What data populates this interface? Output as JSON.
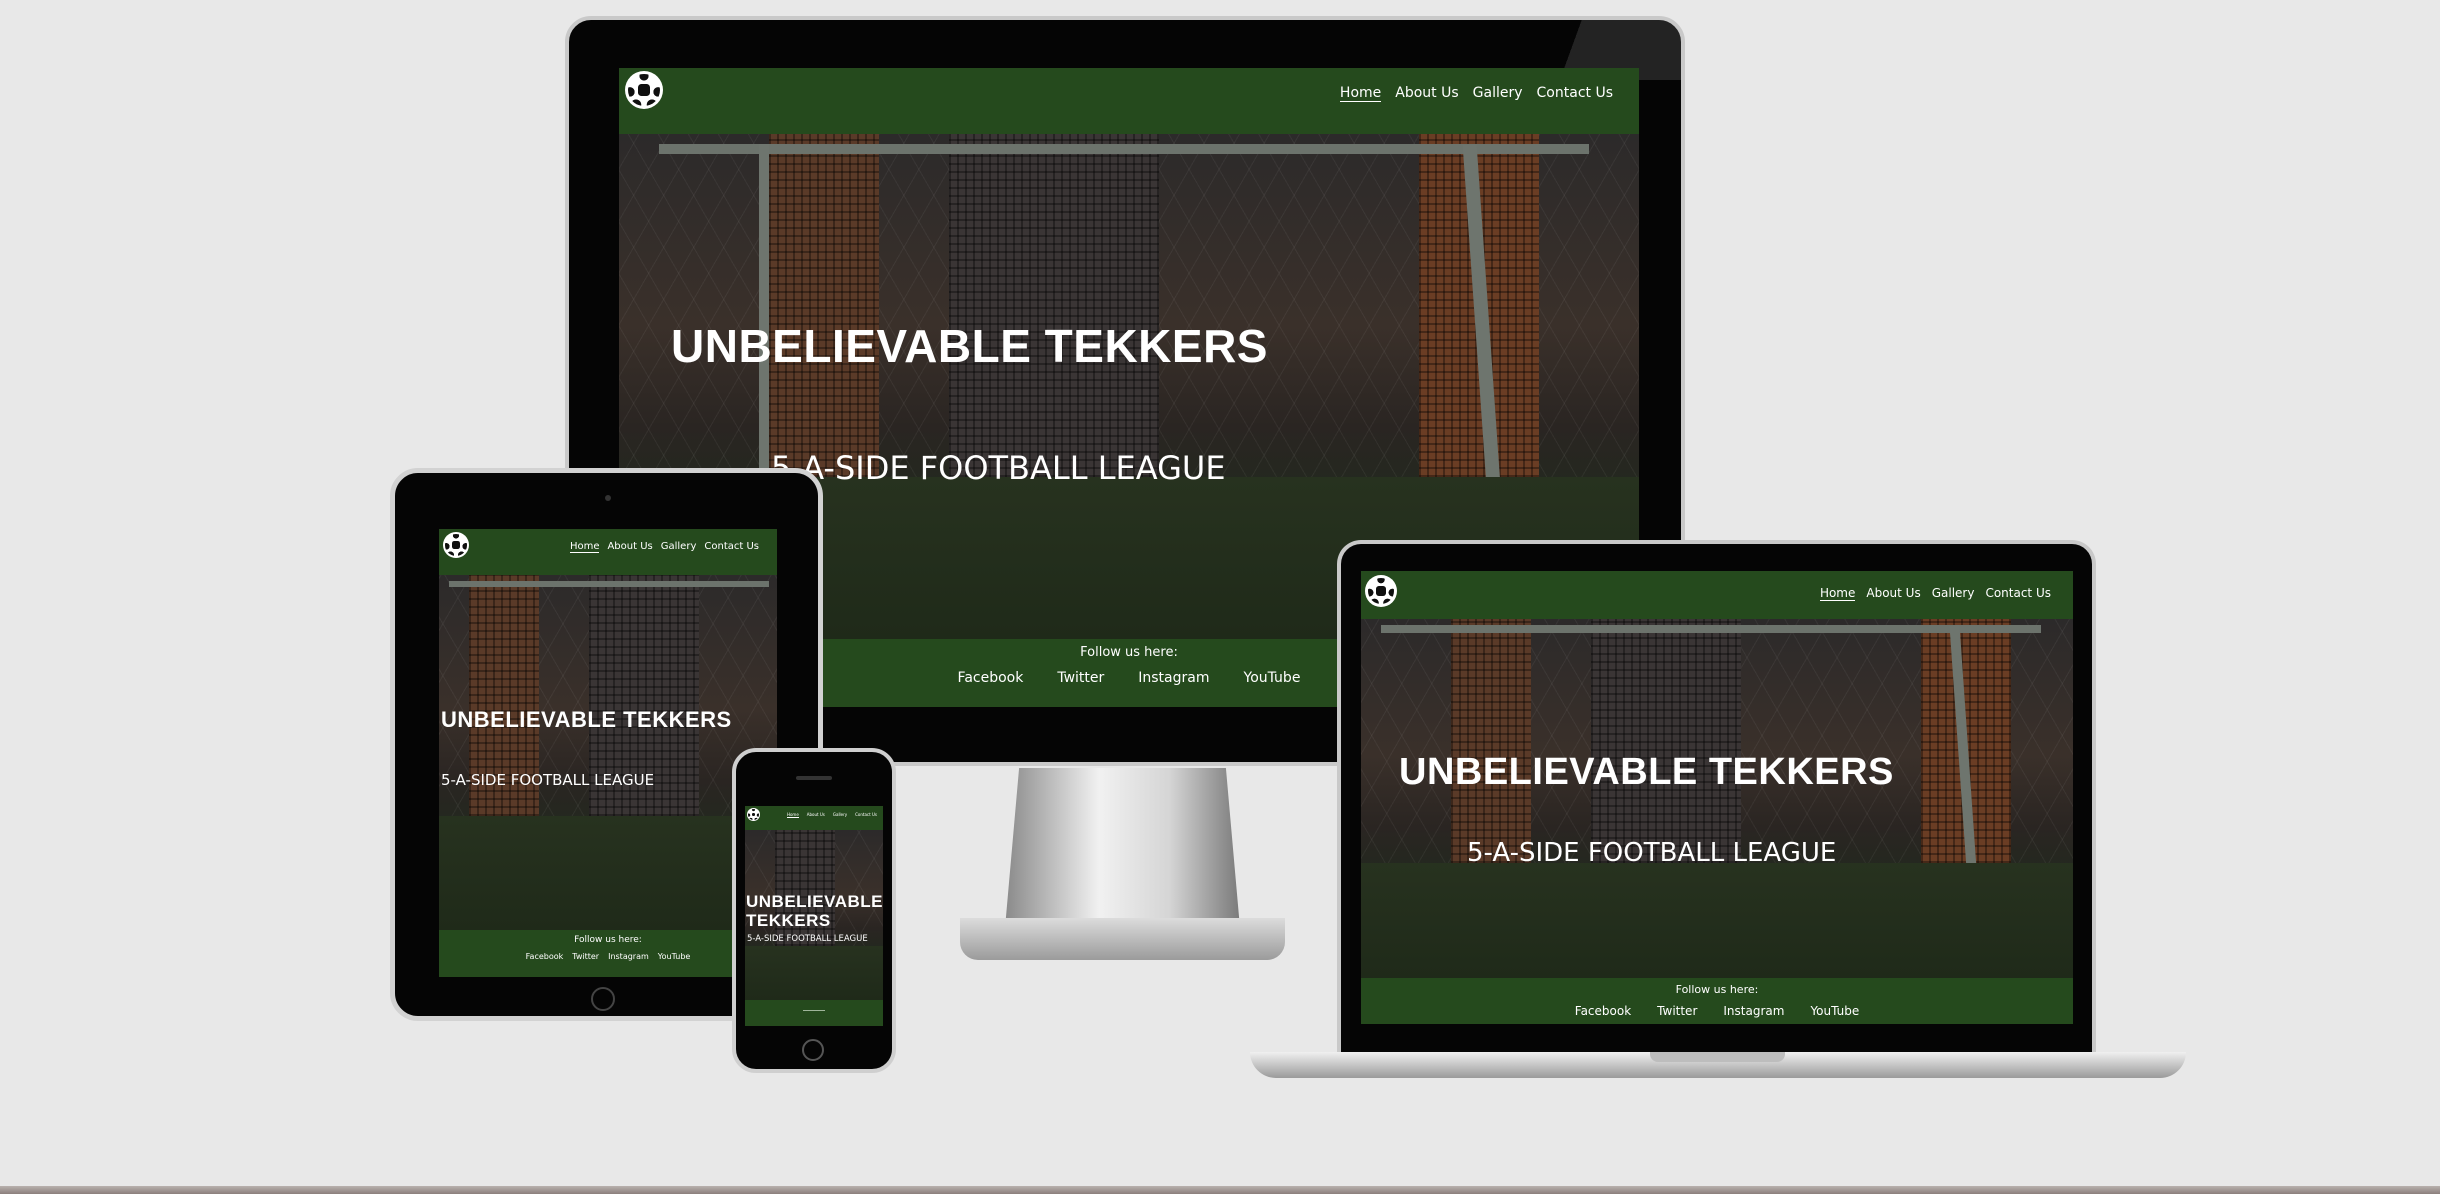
{
  "site": {
    "logo_icon": "soccer-ball-icon",
    "nav": [
      {
        "label": "Home",
        "active": true
      },
      {
        "label": "About Us",
        "active": false
      },
      {
        "label": "Gallery",
        "active": false
      },
      {
        "label": "Contact Us",
        "active": false
      }
    ],
    "hero_title": "UNBELIEVABLE TEKKERS",
    "hero_title_line1": "UNBELIEVABLE",
    "hero_title_line2": "TEKKERS",
    "hero_subtitle": "5-A-SIDE FOOTBALL LEAGUE",
    "footer_heading": "Follow us here:",
    "social": [
      "Facebook",
      "Twitter",
      "Instagram",
      "YouTube"
    ]
  },
  "colors": {
    "brand_green": "#254a1d",
    "background": "#e8e8e8"
  }
}
